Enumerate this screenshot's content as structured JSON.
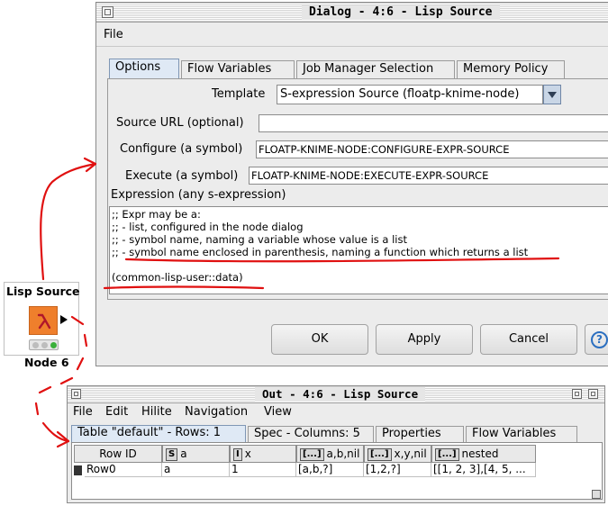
{
  "dialog": {
    "title": "Dialog - 4:6 - Lisp Source",
    "menu": [
      "File"
    ],
    "tabs": [
      "Options",
      "Flow Variables",
      "Job Manager Selection",
      "Memory Policy"
    ],
    "template_label": "Template",
    "template_value": "S-expression Source (floatp-knime-node)",
    "source_url_label": "Source URL (optional)",
    "source_url_value": "",
    "configure_label": "Configure (a symbol)",
    "configure_value": "FLOATP-KNIME-NODE:CONFIGURE-EXPR-SOURCE",
    "execute_label": "Execute (a symbol)",
    "execute_value": "FLOATP-KNIME-NODE:EXECUTE-EXPR-SOURCE",
    "expression_label": "Expression (any s-expression)",
    "expression_lines": [
      ";; Expr may be a:",
      ";; - list, configured in the node dialog",
      ";; - symbol name, naming a variable whose value is a list",
      ";; - symbol name enclosed in parenthesis, naming a function which returns a list",
      "",
      "(common-lisp-user::data)"
    ],
    "buttons": {
      "ok": "OK",
      "apply": "Apply",
      "cancel": "Cancel",
      "help": "?"
    }
  },
  "node": {
    "title": "Lisp Source",
    "caption": "Node 6",
    "icon": "lambda-icon",
    "status": [
      "gray",
      "gray",
      "green"
    ]
  },
  "outwin": {
    "title": "Out - 4:6 - Lisp Source",
    "menu": [
      "File",
      "Edit",
      "Hilite",
      "Navigation",
      "View"
    ],
    "tabs": [
      "Table \"default\" - Rows: 1",
      "Spec - Columns: 5",
      "Properties",
      "Flow Variables"
    ],
    "table": {
      "row_id_header": "Row ID",
      "columns": [
        {
          "type": "S",
          "name": "a"
        },
        {
          "type": "I",
          "name": "x"
        },
        {
          "type": "[...]",
          "name": "a,b,nil"
        },
        {
          "type": "[...]",
          "name": "x,y,nil"
        },
        {
          "type": "[...]",
          "name": "nested"
        }
      ],
      "rows": [
        {
          "id": "Row0",
          "cells": [
            "a",
            "1",
            "[a,b,?]",
            "[1,2,?]",
            "[[1, 2, 3],[4, 5, ..."
          ]
        }
      ]
    }
  },
  "colors": {
    "annotation": "#e01010",
    "node_icon": "#ef7f2c",
    "active_tab": "#dfe9f5"
  }
}
